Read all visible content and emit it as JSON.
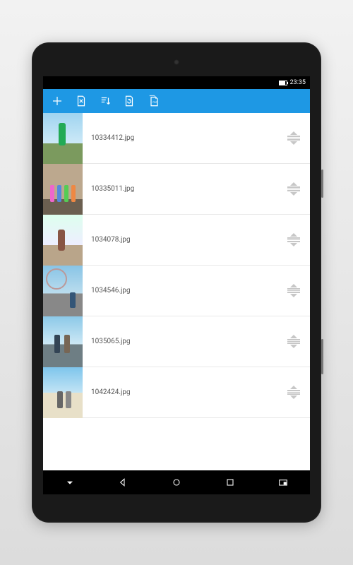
{
  "statusbar": {
    "time": "23:35"
  },
  "toolbar": {
    "icons": [
      "add",
      "clear-list",
      "sort",
      "rotate-page",
      "export-pdf"
    ]
  },
  "files": [
    {
      "name": "10334412.jpg"
    },
    {
      "name": "10335011.jpg"
    },
    {
      "name": "1034078.jpg"
    },
    {
      "name": "1034546.jpg"
    },
    {
      "name": "1035065.jpg"
    },
    {
      "name": "1042424.jpg"
    }
  ],
  "nav": [
    "dropdown",
    "back",
    "home",
    "recent",
    "screenshot"
  ]
}
